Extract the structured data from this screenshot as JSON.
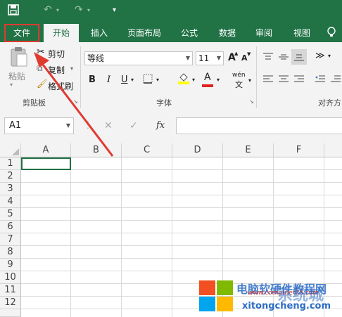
{
  "ribbon_tabs": [
    "文件",
    "开始",
    "插入",
    "页面布局",
    "公式",
    "数据",
    "审阅",
    "视图"
  ],
  "clipboard": {
    "paste": "粘贴",
    "cut": "剪切",
    "copy": "复制",
    "format_painter": "格式刷",
    "group_label": "剪贴板"
  },
  "font": {
    "name": "等线",
    "size": "11",
    "group_label": "字体",
    "bold": "B",
    "italic": "I",
    "underline": "U",
    "phonetic": "wén",
    "grow": "A",
    "shrink": "A"
  },
  "alignment": {
    "group_label": "对齐方"
  },
  "name_box": {
    "value": "A1"
  },
  "formula": {
    "fx": "fx"
  },
  "columns": [
    "A",
    "B",
    "C",
    "D",
    "E",
    "F"
  ],
  "rows": [
    "1",
    "2",
    "3",
    "4",
    "5",
    "6",
    "7",
    "8",
    "9",
    "10",
    "11",
    "12"
  ],
  "watermark": {
    "brand": "电脑软硬件教程网",
    "url": "www.computer26.com",
    "brand2": "系统城",
    "url2": "xitongcheng.com"
  },
  "colors": {
    "excel_green": "#217346",
    "highlight_red": "#e03a2f",
    "font_red": "#e0211c",
    "highlight_yellow": "#ffff00"
  }
}
